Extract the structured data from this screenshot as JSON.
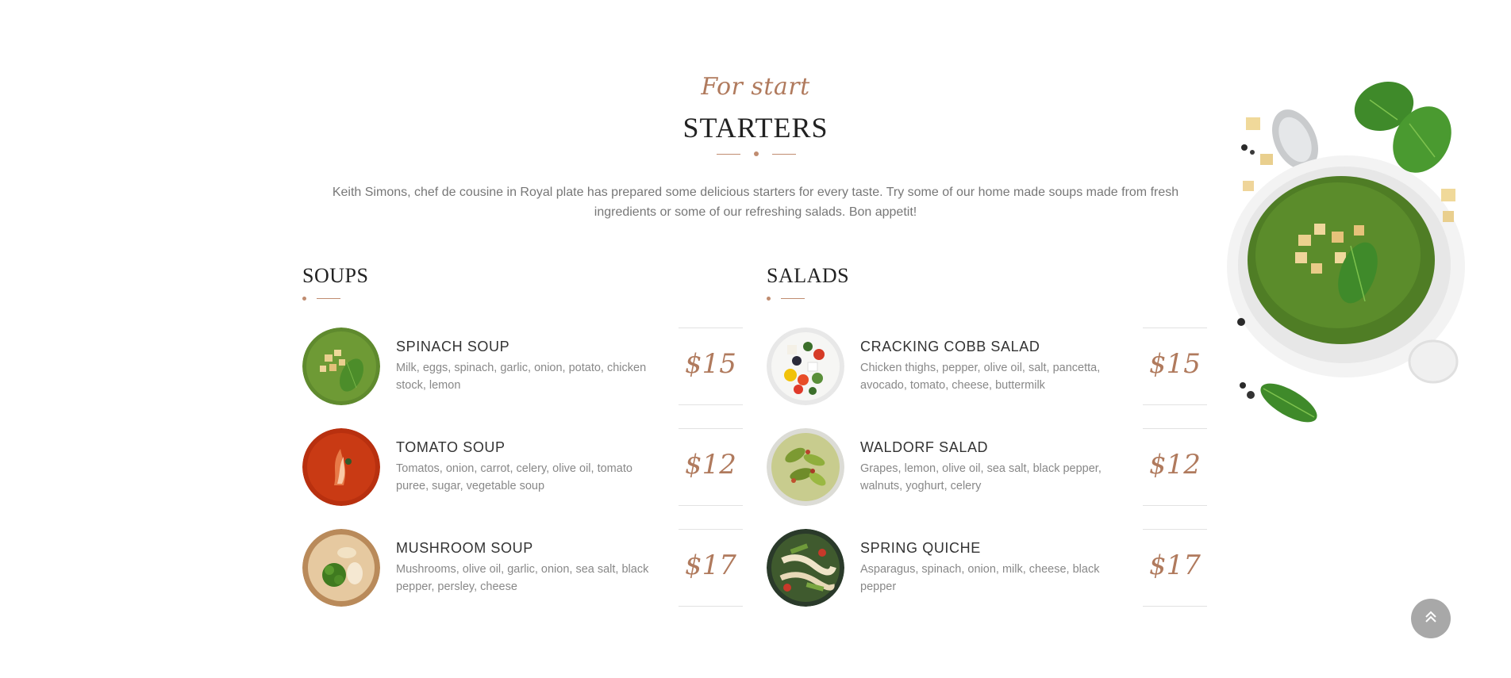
{
  "section": {
    "script_title": "For start",
    "title": "STARTERS",
    "intro": "Keith Simons, chef de cousine in Royal plate has prepared some delicious starters for every taste. Try some of our home made soups made from fresh ingredients or some of our refreshing salads. Bon appetit!"
  },
  "categories": [
    {
      "title": "SOUPS",
      "items": [
        {
          "name": "SPINACH SOUP",
          "desc": "Milk, eggs, spinach, garlic, onion, potato, chicken stock, lemon",
          "price": "$15"
        },
        {
          "name": "TOMATO SOUP",
          "desc": "Tomatos, onion, carrot, celery, olive oil, tomato puree, sugar, vegetable soup",
          "price": "$12"
        },
        {
          "name": "MUSHROOM SOUP",
          "desc": "Mushrooms, olive oil, garlic, onion, sea salt, black pepper, persley, cheese",
          "price": "$17"
        }
      ]
    },
    {
      "title": "SALADS",
      "items": [
        {
          "name": "CRACKING COBB SALAD",
          "desc": "Chicken thighs, pepper, olive oil, salt, pancetta, avocado, tomato, cheese, buttermilk",
          "price": "$15"
        },
        {
          "name": "WALDORF SALAD",
          "desc": "Grapes, lemon, olive oil, sea salt, black pepper, walnuts, yoghurt, celery",
          "price": "$12"
        },
        {
          "name": "SPRING QUICHE",
          "desc": "Asparagus, spinach, onion, milk, cheese, black pepper",
          "price": "$17"
        }
      ]
    }
  ],
  "colors": {
    "accent": "#b07a5d",
    "divider": "#c08c70",
    "scroll_button": "#a8a8a8"
  },
  "icons": {
    "scroll_top": "double-chevron-up-icon"
  }
}
